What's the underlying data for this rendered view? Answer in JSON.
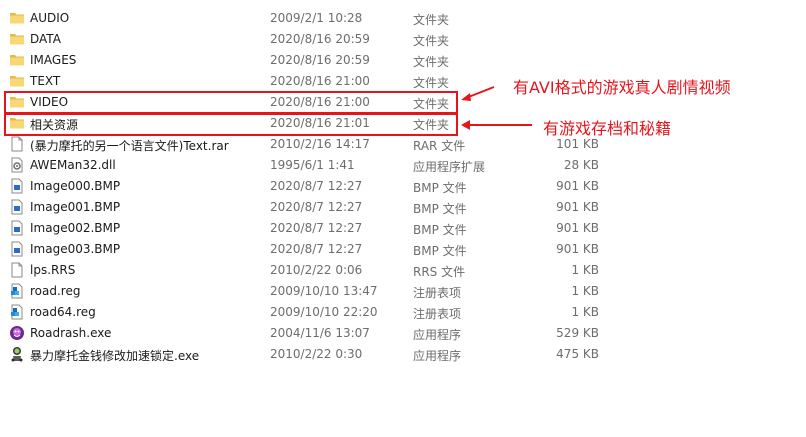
{
  "files": [
    {
      "name": "AUDIO",
      "date": "2009/2/1 10:28",
      "type": "文件夹",
      "size": "",
      "icon": "folder-icon"
    },
    {
      "name": "DATA",
      "date": "2020/8/16 20:59",
      "type": "文件夹",
      "size": "",
      "icon": "folder-icon"
    },
    {
      "name": "IMAGES",
      "date": "2020/8/16 20:59",
      "type": "文件夹",
      "size": "",
      "icon": "folder-icon"
    },
    {
      "name": "TEXT",
      "date": "2020/8/16 21:00",
      "type": "文件夹",
      "size": "",
      "icon": "folder-icon"
    },
    {
      "name": "VIDEO",
      "date": "2020/8/16 21:00",
      "type": "文件夹",
      "size": "",
      "icon": "folder-icon"
    },
    {
      "name": "相关资源",
      "date": "2020/8/16 21:01",
      "type": "文件夹",
      "size": "",
      "icon": "folder-icon"
    },
    {
      "name": "(暴力摩托的另一个语言文件)Text.rar",
      "date": "2010/2/16 14:17",
      "type": "RAR 文件",
      "size": "101 KB",
      "icon": "document-icon"
    },
    {
      "name": "AWEMan32.dll",
      "date": "1995/6/1 1:41",
      "type": "应用程序扩展",
      "size": "28 KB",
      "icon": "dll-icon"
    },
    {
      "name": "Image000.BMP",
      "date": "2020/8/7 12:27",
      "type": "BMP 文件",
      "size": "901 KB",
      "icon": "image-icon"
    },
    {
      "name": "Image001.BMP",
      "date": "2020/8/7 12:27",
      "type": "BMP 文件",
      "size": "901 KB",
      "icon": "image-icon"
    },
    {
      "name": "Image002.BMP",
      "date": "2020/8/7 12:27",
      "type": "BMP 文件",
      "size": "901 KB",
      "icon": "image-icon"
    },
    {
      "name": "Image003.BMP",
      "date": "2020/8/7 12:27",
      "type": "BMP 文件",
      "size": "901 KB",
      "icon": "image-icon"
    },
    {
      "name": "lps.RRS",
      "date": "2010/2/22 0:06",
      "type": "RRS 文件",
      "size": "1 KB",
      "icon": "document-icon"
    },
    {
      "name": "road.reg",
      "date": "2009/10/10 13:47",
      "type": "注册表项",
      "size": "1 KB",
      "icon": "registry-icon"
    },
    {
      "name": "road64.reg",
      "date": "2009/10/10 22:20",
      "type": "注册表项",
      "size": "1 KB",
      "icon": "registry-icon"
    },
    {
      "name": "Roadrash.exe",
      "date": "2004/11/6 13:07",
      "type": "应用程序",
      "size": "529 KB",
      "icon": "game-app-icon"
    },
    {
      "name": "暴力摩托金钱修改加速锁定.exe",
      "date": "2010/2/22 0:30",
      "type": "应用程序",
      "size": "475 KB",
      "icon": "trainer-app-icon"
    }
  ],
  "annotations": {
    "video_note": "有AVI格式的游戏真人剧情视频",
    "resources_note": "有游戏存档和秘籍",
    "highlight_color": "#e8141c"
  }
}
